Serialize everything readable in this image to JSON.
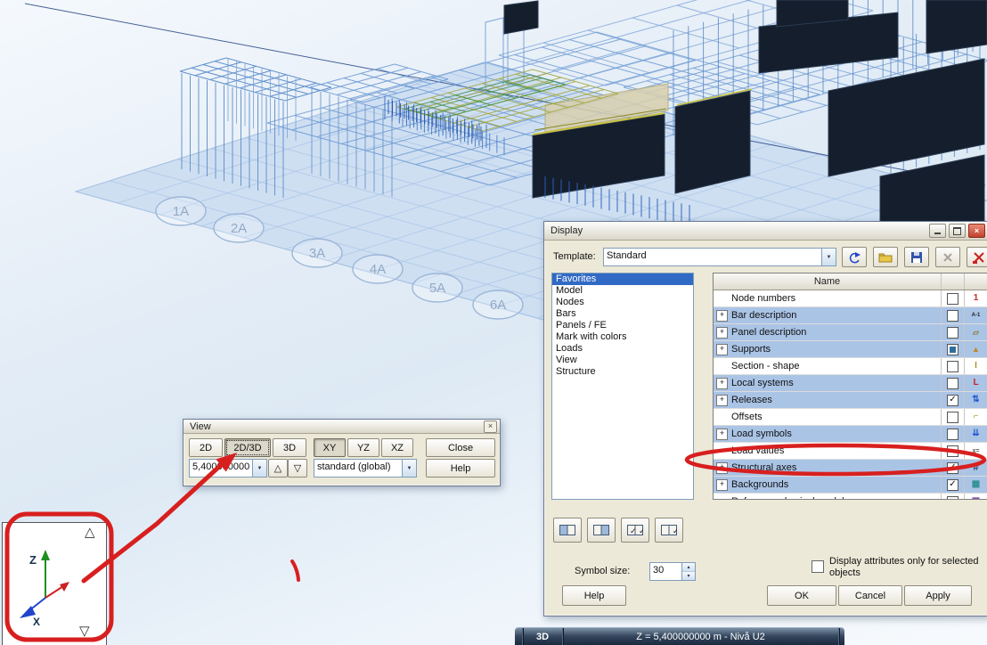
{
  "viewport": {
    "grid_bubbles": [
      {
        "label": "1A"
      },
      {
        "label": "2A"
      },
      {
        "label": "3A"
      },
      {
        "label": "4A"
      },
      {
        "label": "5A"
      },
      {
        "label": "6A"
      }
    ]
  },
  "axis_triad": {
    "z_label": "Z",
    "x_label": "X"
  },
  "view_dialog": {
    "title": "View",
    "mode_buttons": [
      {
        "label": "2D",
        "pressed": false
      },
      {
        "label": "2D/3D",
        "pressed": true
      },
      {
        "label": "3D",
        "pressed": false
      }
    ],
    "plane_buttons": [
      {
        "label": "XY",
        "pressed": true
      },
      {
        "label": "YZ",
        "pressed": false
      },
      {
        "label": "XZ",
        "pressed": false
      }
    ],
    "close_button": "Close",
    "help_button": "Help",
    "level_combo_value": "5,400000000",
    "projection_combo_value": "standard (global)"
  },
  "display_dialog": {
    "title": "Display",
    "template_label": "Template:",
    "template_value": "Standard",
    "toolbar_icons": [
      "reload-template-icon",
      "open-folder-icon",
      "save-icon",
      "delete-icon",
      "remove-template-icon"
    ],
    "categories": [
      "Favorites",
      "Model",
      "Nodes",
      "Bars",
      "Panels / FE",
      "Mark with colors",
      "Loads",
      "View",
      "Structure"
    ],
    "selected_category": "Favorites",
    "table": {
      "header": "Name",
      "rows": [
        {
          "label": "Node numbers",
          "expandable": false,
          "state": "unchecked",
          "highlight": false,
          "icon": "node-numbers-icon"
        },
        {
          "label": "Bar description",
          "expandable": true,
          "state": "unchecked",
          "highlight": true,
          "icon": "bar-description-icon"
        },
        {
          "label": "Panel description",
          "expandable": true,
          "state": "unchecked",
          "highlight": true,
          "icon": "panel-description-icon"
        },
        {
          "label": "Supports",
          "expandable": true,
          "state": "filled",
          "highlight": true,
          "icon": "supports-icon"
        },
        {
          "label": "Section - shape",
          "expandable": false,
          "state": "unchecked",
          "highlight": false,
          "icon": "section-shape-icon"
        },
        {
          "label": "Local systems",
          "expandable": true,
          "state": "unchecked",
          "highlight": true,
          "icon": "local-systems-icon"
        },
        {
          "label": "Releases",
          "expandable": true,
          "state": "checked",
          "highlight": true,
          "icon": "releases-icon"
        },
        {
          "label": "Offsets",
          "expandable": false,
          "state": "unchecked",
          "highlight": false,
          "icon": "offsets-icon"
        },
        {
          "label": "Load symbols",
          "expandable": true,
          "state": "unchecked",
          "highlight": true,
          "icon": "load-symbols-icon"
        },
        {
          "label": "Load values",
          "expandable": false,
          "state": "unchecked",
          "highlight": false,
          "icon": "load-values-icon"
        },
        {
          "label": "Structural axes",
          "expandable": true,
          "state": "checked",
          "highlight": true,
          "annotated": true,
          "icon": "structural-axes-icon"
        },
        {
          "label": "Backgrounds",
          "expandable": true,
          "state": "checked",
          "highlight": true,
          "icon": "backgrounds-icon"
        },
        {
          "label": "Reference physical model",
          "expandable": false,
          "state": "unchecked",
          "highlight": false,
          "icon": "reference-model-icon"
        }
      ]
    },
    "symbol_size_label": "Symbol size:",
    "symbol_size_value": "30",
    "attributes_checkbox": {
      "checked": false,
      "label": "Display attributes only for selected objects"
    },
    "buttons": {
      "help": "Help",
      "ok": "OK",
      "cancel": "Cancel",
      "apply": "Apply"
    }
  },
  "status_bar": {
    "view_mode": "3D",
    "position": "Z = 5,400000000 m - Nivå U2"
  },
  "colors": {
    "annotation": "#d81f1f",
    "selection": "#316ac5",
    "row_highlight": "#aac4e6",
    "wireframe": "#6f9cd4",
    "dark_fill": "#141e2c"
  }
}
